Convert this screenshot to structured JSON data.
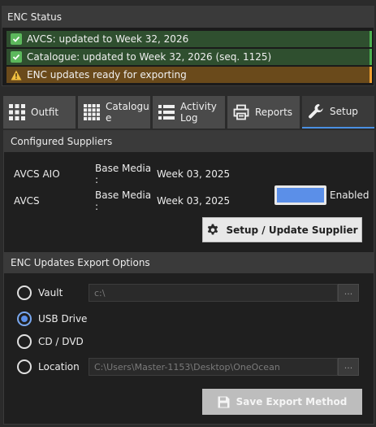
{
  "status": {
    "title": "ENC Status",
    "items": [
      {
        "text": "AVCS: updated to Week 32, 2026",
        "level": "ok"
      },
      {
        "text": "Catalogue: updated to Week 32, 2026 (seq. 1125)",
        "level": "ok"
      },
      {
        "text": "ENC updates ready for exporting",
        "level": "warning"
      }
    ]
  },
  "tabs": [
    {
      "label": "Outfit",
      "icon": "grid-icon"
    },
    {
      "label": "Catalogu e",
      "icon": "grid-dots-icon"
    },
    {
      "label": "Activity Log",
      "icon": "list-icon"
    },
    {
      "label": "Reports",
      "icon": "printer-icon"
    },
    {
      "label": "Setup",
      "icon": "wrench-icon",
      "active": true
    }
  ],
  "suppliers": {
    "title": "Configured Suppliers",
    "rows": [
      {
        "name": "AVCS AIO",
        "media_label": "Base Media :",
        "media_value": "Week 03, 2025"
      },
      {
        "name": "AVCS",
        "media_label": "Base Media :",
        "media_value": "Week 03, 2025"
      }
    ],
    "toggle_label": "Enabled",
    "setup_button": "Setup / Update Supplier"
  },
  "export": {
    "title": "ENC Updates Export Options",
    "options": [
      {
        "label": "Vault",
        "checked": false,
        "path": "c:\\",
        "browse": "..."
      },
      {
        "label": "USB Drive",
        "checked": true
      },
      {
        "label": "CD / DVD",
        "checked": false
      },
      {
        "label": "Location",
        "checked": false,
        "path": "C:\\Users\\Master-1153\\Desktop\\OneOcean",
        "browse": "..."
      }
    ],
    "save_button": "Save Export Method"
  },
  "colors": {
    "ok": "#5cb85c",
    "warning": "#f0a030",
    "accent": "#4a90e2"
  }
}
